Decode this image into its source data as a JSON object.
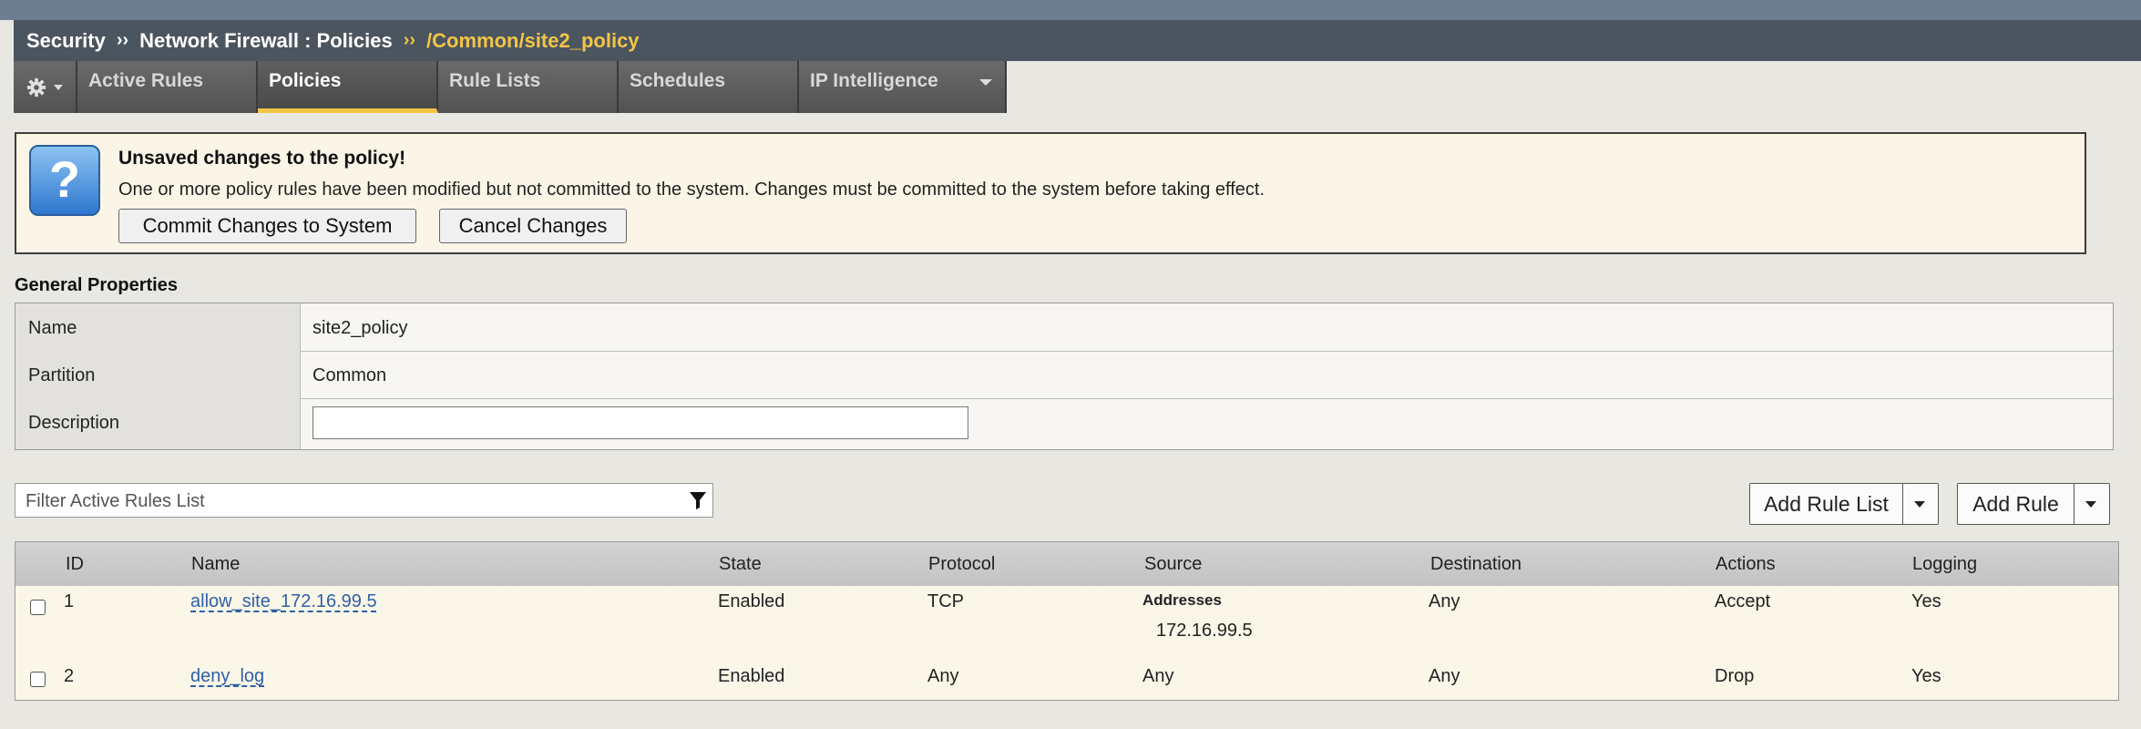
{
  "breadcrumb": {
    "items": [
      "Security",
      "Network Firewall : Policies"
    ],
    "separator": "››",
    "current": "/Common/site2_policy"
  },
  "tabs": [
    {
      "label": "Active Rules",
      "active": false
    },
    {
      "label": "Policies",
      "active": true
    },
    {
      "label": "Rule Lists",
      "active": false
    },
    {
      "label": "Schedules",
      "active": false
    },
    {
      "label": "IP Intelligence",
      "active": false,
      "has_dropdown": true
    }
  ],
  "notice": {
    "title": "Unsaved changes to the policy!",
    "message": "One or more policy rules have been modified but not committed to the system. Changes must be committed to the system before taking effect.",
    "commit_label": "Commit Changes to System",
    "cancel_label": "Cancel Changes",
    "icon": "?"
  },
  "general_properties": {
    "title": "General Properties",
    "name_label": "Name",
    "name_value": "site2_policy",
    "partition_label": "Partition",
    "partition_value": "Common",
    "description_label": "Description",
    "description_value": ""
  },
  "filter": {
    "placeholder": "Filter Active Rules List"
  },
  "actions": {
    "add_rule_list": "Add Rule List",
    "add_rule": "Add Rule"
  },
  "rules_table": {
    "headers": {
      "id": "ID",
      "name": "Name",
      "state": "State",
      "protocol": "Protocol",
      "source": "Source",
      "destination": "Destination",
      "actions": "Actions",
      "logging": "Logging"
    },
    "rows": [
      {
        "id": "1",
        "name": "allow_site_172.16.99.5",
        "state": "Enabled",
        "protocol": "TCP",
        "source_header": "Addresses",
        "source": "172.16.99.5",
        "destination": "Any",
        "action": "Accept",
        "logging": "Yes"
      },
      {
        "id": "2",
        "name": "deny_log",
        "state": "Enabled",
        "protocol": "Any",
        "source": "Any",
        "destination": "Any",
        "action": "Drop",
        "logging": "Yes"
      }
    ]
  }
}
